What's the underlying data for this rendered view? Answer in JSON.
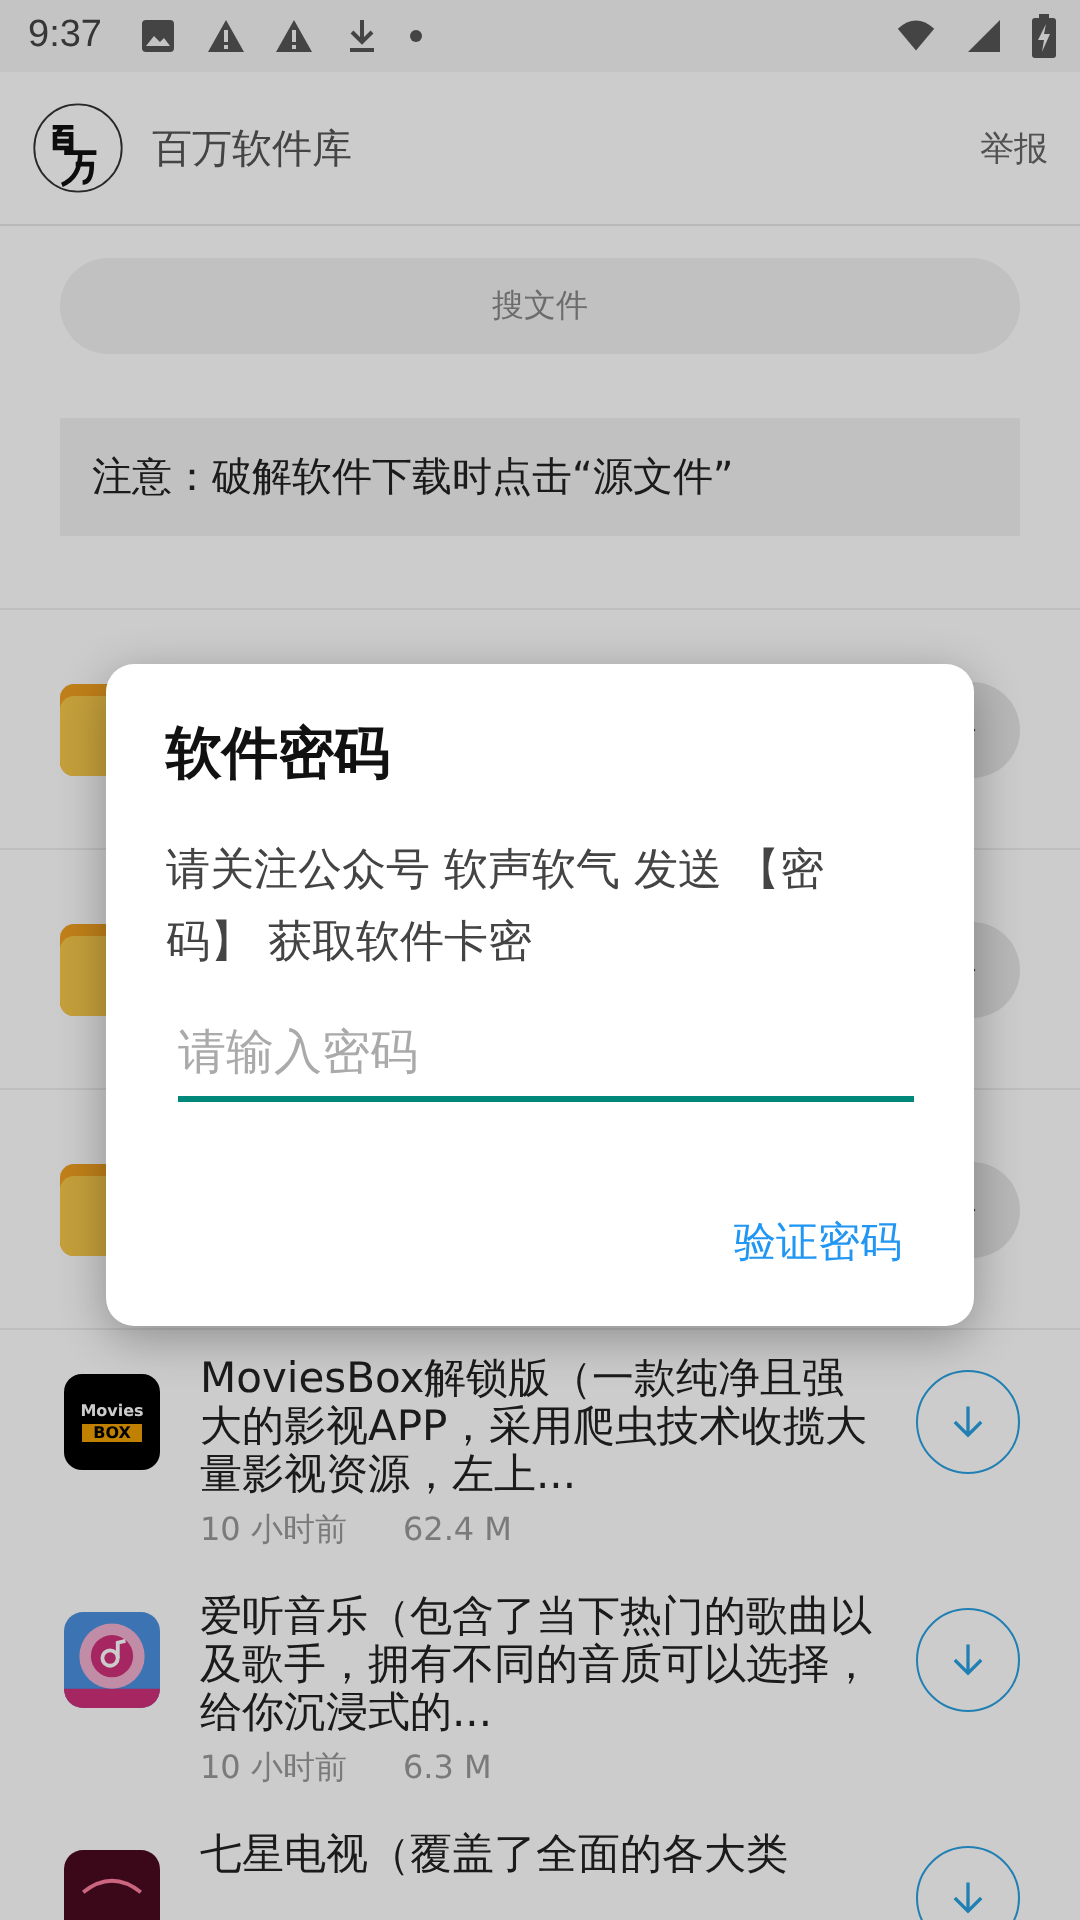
{
  "status_bar": {
    "time": "9:37"
  },
  "app_bar": {
    "title": "百万软件库",
    "action": "举报"
  },
  "search": {
    "placeholder": "搜文件"
  },
  "notice": "注意：破解软件下载时点击“源文件”",
  "folders": [
    {
      "kind": "folder"
    },
    {
      "kind": "folder"
    },
    {
      "kind": "folder"
    }
  ],
  "apps": [
    {
      "kind": "movies",
      "icon_texts": [
        "Movies",
        "BOX"
      ],
      "title": "MoviesBox解锁版（一款纯净且强大的影视APP，采用爬虫技术收揽大量影视资源，左上...",
      "time": "10 小时前",
      "size": "62.4 M"
    },
    {
      "kind": "music",
      "title": "爱听音乐（包含了当下热门的歌曲以及歌手，拥有不同的音质可以选择，给你沉浸式的...",
      "time": "10 小时前",
      "size": "6.3 M"
    },
    {
      "kind": "tv",
      "title": "七星电视（覆盖了全面的各大类"
    }
  ],
  "dialog": {
    "title": "软件密码",
    "message": "请关注公众号 软声软气 发送 【密码】 获取软件卡密",
    "input_placeholder": "请输入密码",
    "button": "验证密码"
  }
}
